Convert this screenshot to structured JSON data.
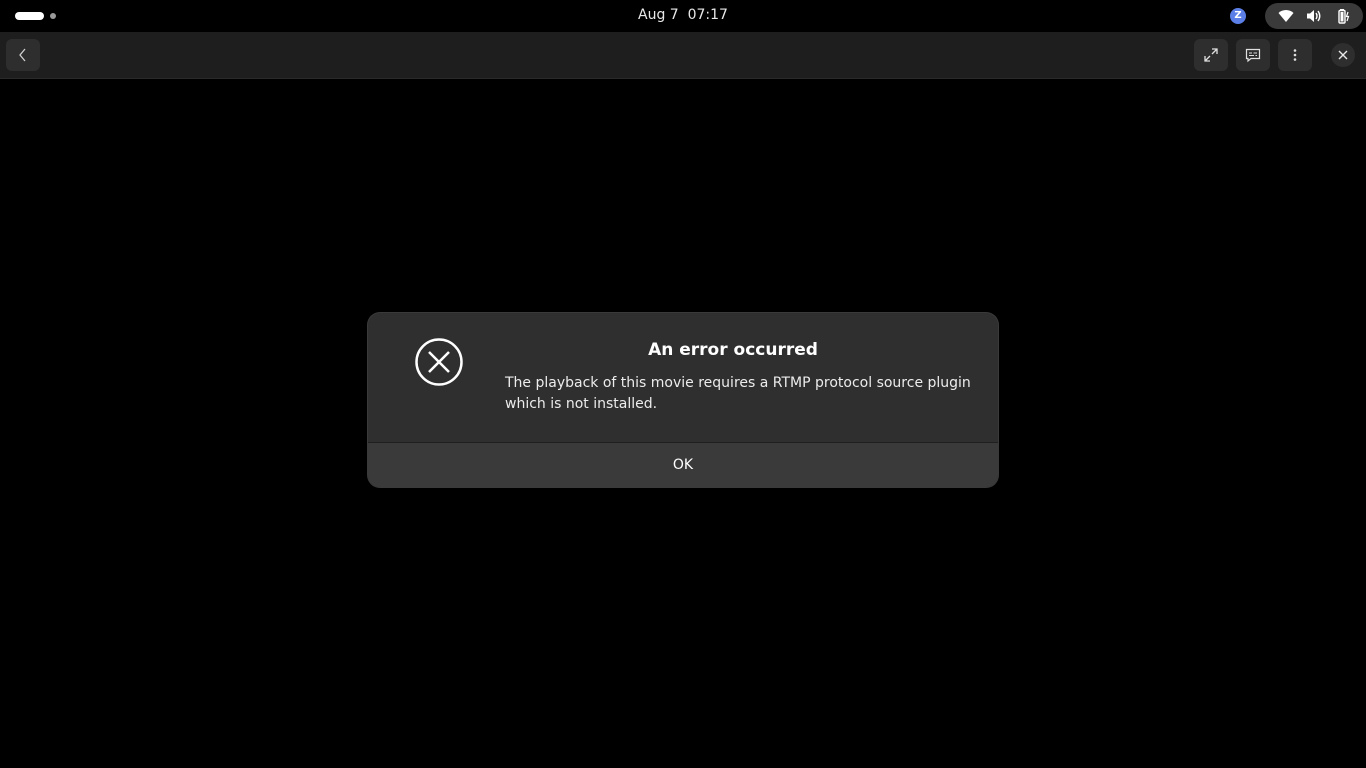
{
  "topbar": {
    "clock": "Aug 7  07:17",
    "tray_app_glyph": "Z",
    "icons": [
      "workspace-indicator",
      "wifi-icon",
      "volume-icon",
      "battery-icon"
    ]
  },
  "headerbar": {
    "icons": [
      "back-icon",
      "fullscreen-icon",
      "subtitles-icon",
      "menu-icon",
      "close-icon"
    ]
  },
  "dialog": {
    "title": "An error occurred",
    "message": "The playback of this movie requires a RTMP protocol source plugin which is not installed.",
    "ok_label": "OK",
    "icon": "error-circle-icon"
  },
  "colors": {
    "background": "#000000",
    "headerbar": "#1e1e1e",
    "dialog": "#2f2f2f",
    "dialog_button": "#3a3a3a",
    "accent_blue": "#5b7fe6"
  }
}
